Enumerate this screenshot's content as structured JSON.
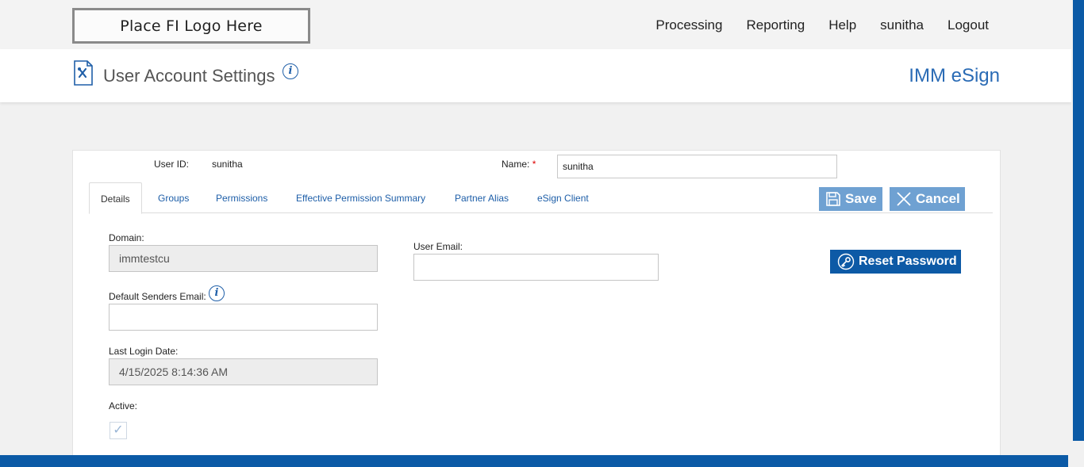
{
  "header": {
    "logo_text": "Place FI Logo Here",
    "nav": [
      "Processing",
      "Reporting",
      "Help",
      "sunitha",
      "Logout"
    ]
  },
  "titlebar": {
    "title": "User Account Settings",
    "brand": "IMM eSign"
  },
  "form": {
    "user_id_label": "User ID:",
    "user_id_value": "sunitha",
    "name_label": "Name:",
    "name_required_mark": "*",
    "name_value": "sunitha"
  },
  "tabs": [
    {
      "label": "Details",
      "active": true
    },
    {
      "label": "Groups"
    },
    {
      "label": "Permissions"
    },
    {
      "label": "Effective Permission Summary"
    },
    {
      "label": "Partner Alias"
    },
    {
      "label": "eSign Client"
    }
  ],
  "actions": {
    "save_label": "Save",
    "cancel_label": "Cancel",
    "reset_password_label": "Reset Password"
  },
  "details": {
    "domain_label": "Domain:",
    "domain_value": "immtestcu",
    "user_email_label": "User Email:",
    "user_email_value": "",
    "default_senders_email_label": "Default Senders Email:",
    "default_senders_email_value": "",
    "last_login_label": "Last Login Date:",
    "last_login_value": "4/15/2025 8:14:36 AM",
    "active_label": "Active:",
    "active_checked": true
  },
  "colors": {
    "accent": "#0b5aa6",
    "button_light": "#6fa1d2",
    "link": "#1d5ea8"
  }
}
